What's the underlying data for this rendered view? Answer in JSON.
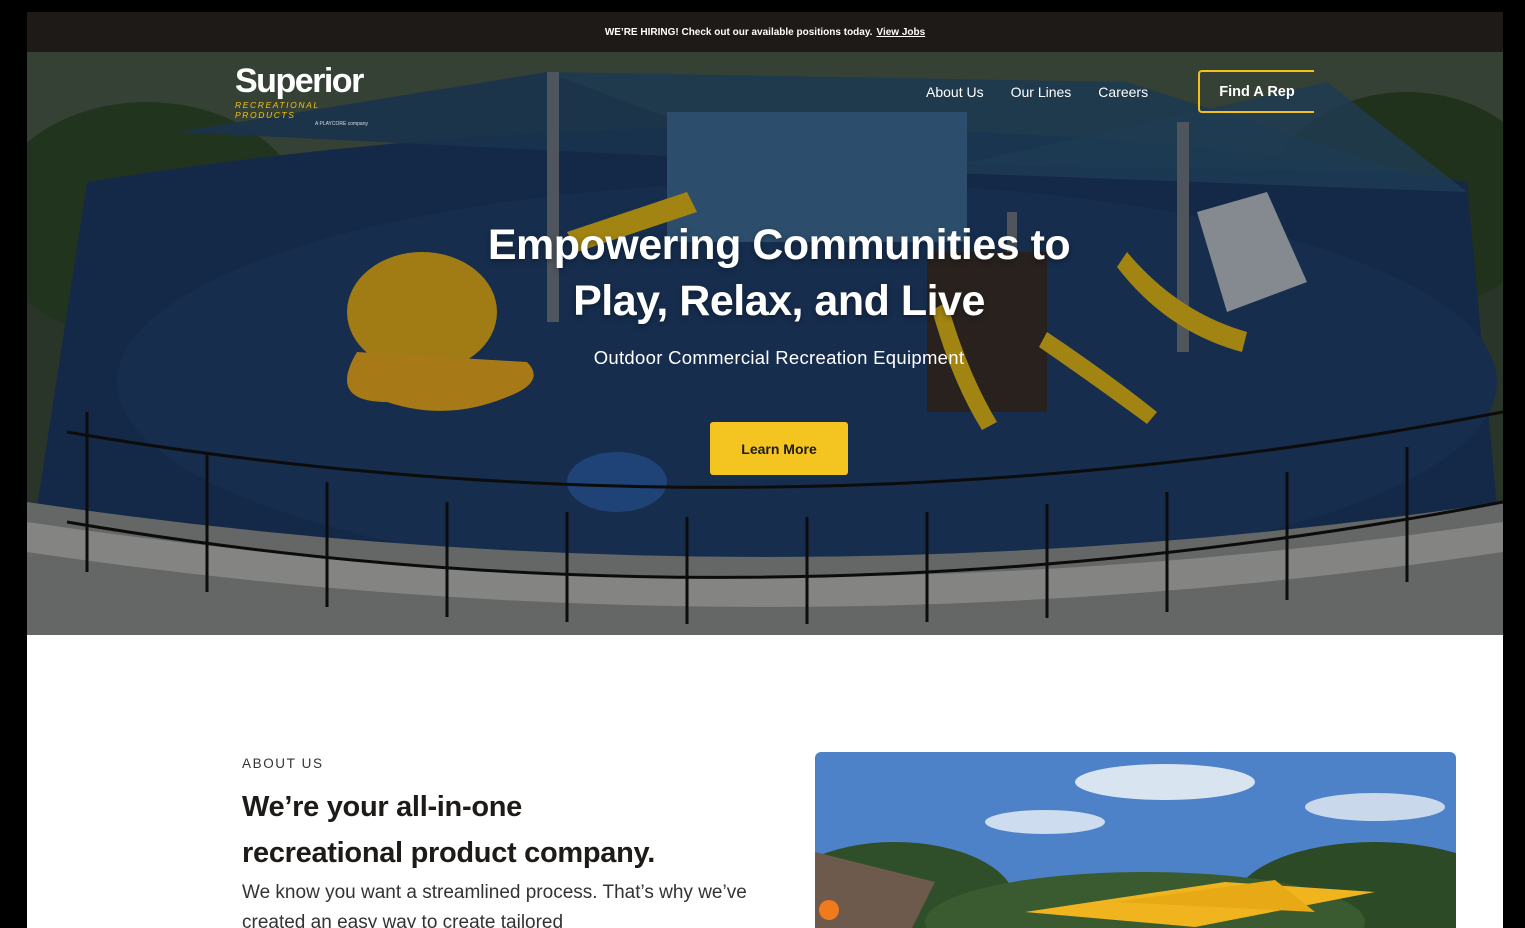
{
  "announcement": {
    "text": "WE’RE HIRING! Check out our available positions today.",
    "link": "View Jobs"
  },
  "logo": {
    "wordmark": "Superior",
    "subtitle": "RECREATIONAL PRODUCTS",
    "parent": "A PLAYCORE company"
  },
  "nav": {
    "items": [
      "About Us",
      "Our Lines",
      "Careers"
    ],
    "cta": "Find A Rep"
  },
  "hero": {
    "title_line1": "Empowering Communities to",
    "title_line2": "Play, Relax, and Live",
    "subtitle": "Outdoor Commercial Recreation Equipment",
    "button": "Learn More"
  },
  "about": {
    "eyebrow": "ABOUT US",
    "title_line1": "We’re your all-in-one",
    "title_line2": "recreational product company.",
    "body": "We know you want a streamlined process. That’s why we’ve created an easy way to create tailored"
  },
  "colors": {
    "accent": "#f2c11a",
    "dark": "#1e1a17"
  }
}
